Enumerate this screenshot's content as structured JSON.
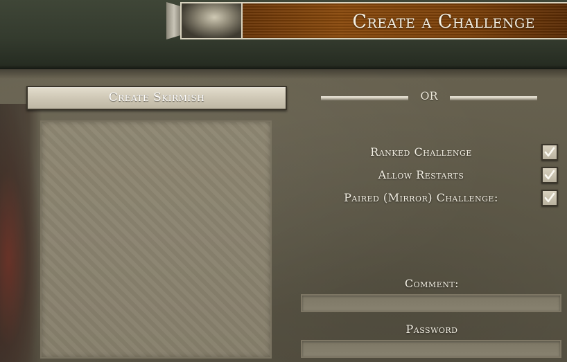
{
  "header": {
    "title": "Create a Challenge"
  },
  "skirmish": {
    "button_label": "Create Skirmish"
  },
  "divider": {
    "text": "OR"
  },
  "options": [
    {
      "label": "Ranked Challenge",
      "checked": true
    },
    {
      "label": "Allow Restarts",
      "checked": true
    },
    {
      "label": "Paired (Mirror) Challenge:",
      "checked": true
    }
  ],
  "fields": {
    "comment": {
      "label": "Comment:",
      "value": ""
    },
    "password": {
      "label": "Password",
      "value": ""
    }
  }
}
